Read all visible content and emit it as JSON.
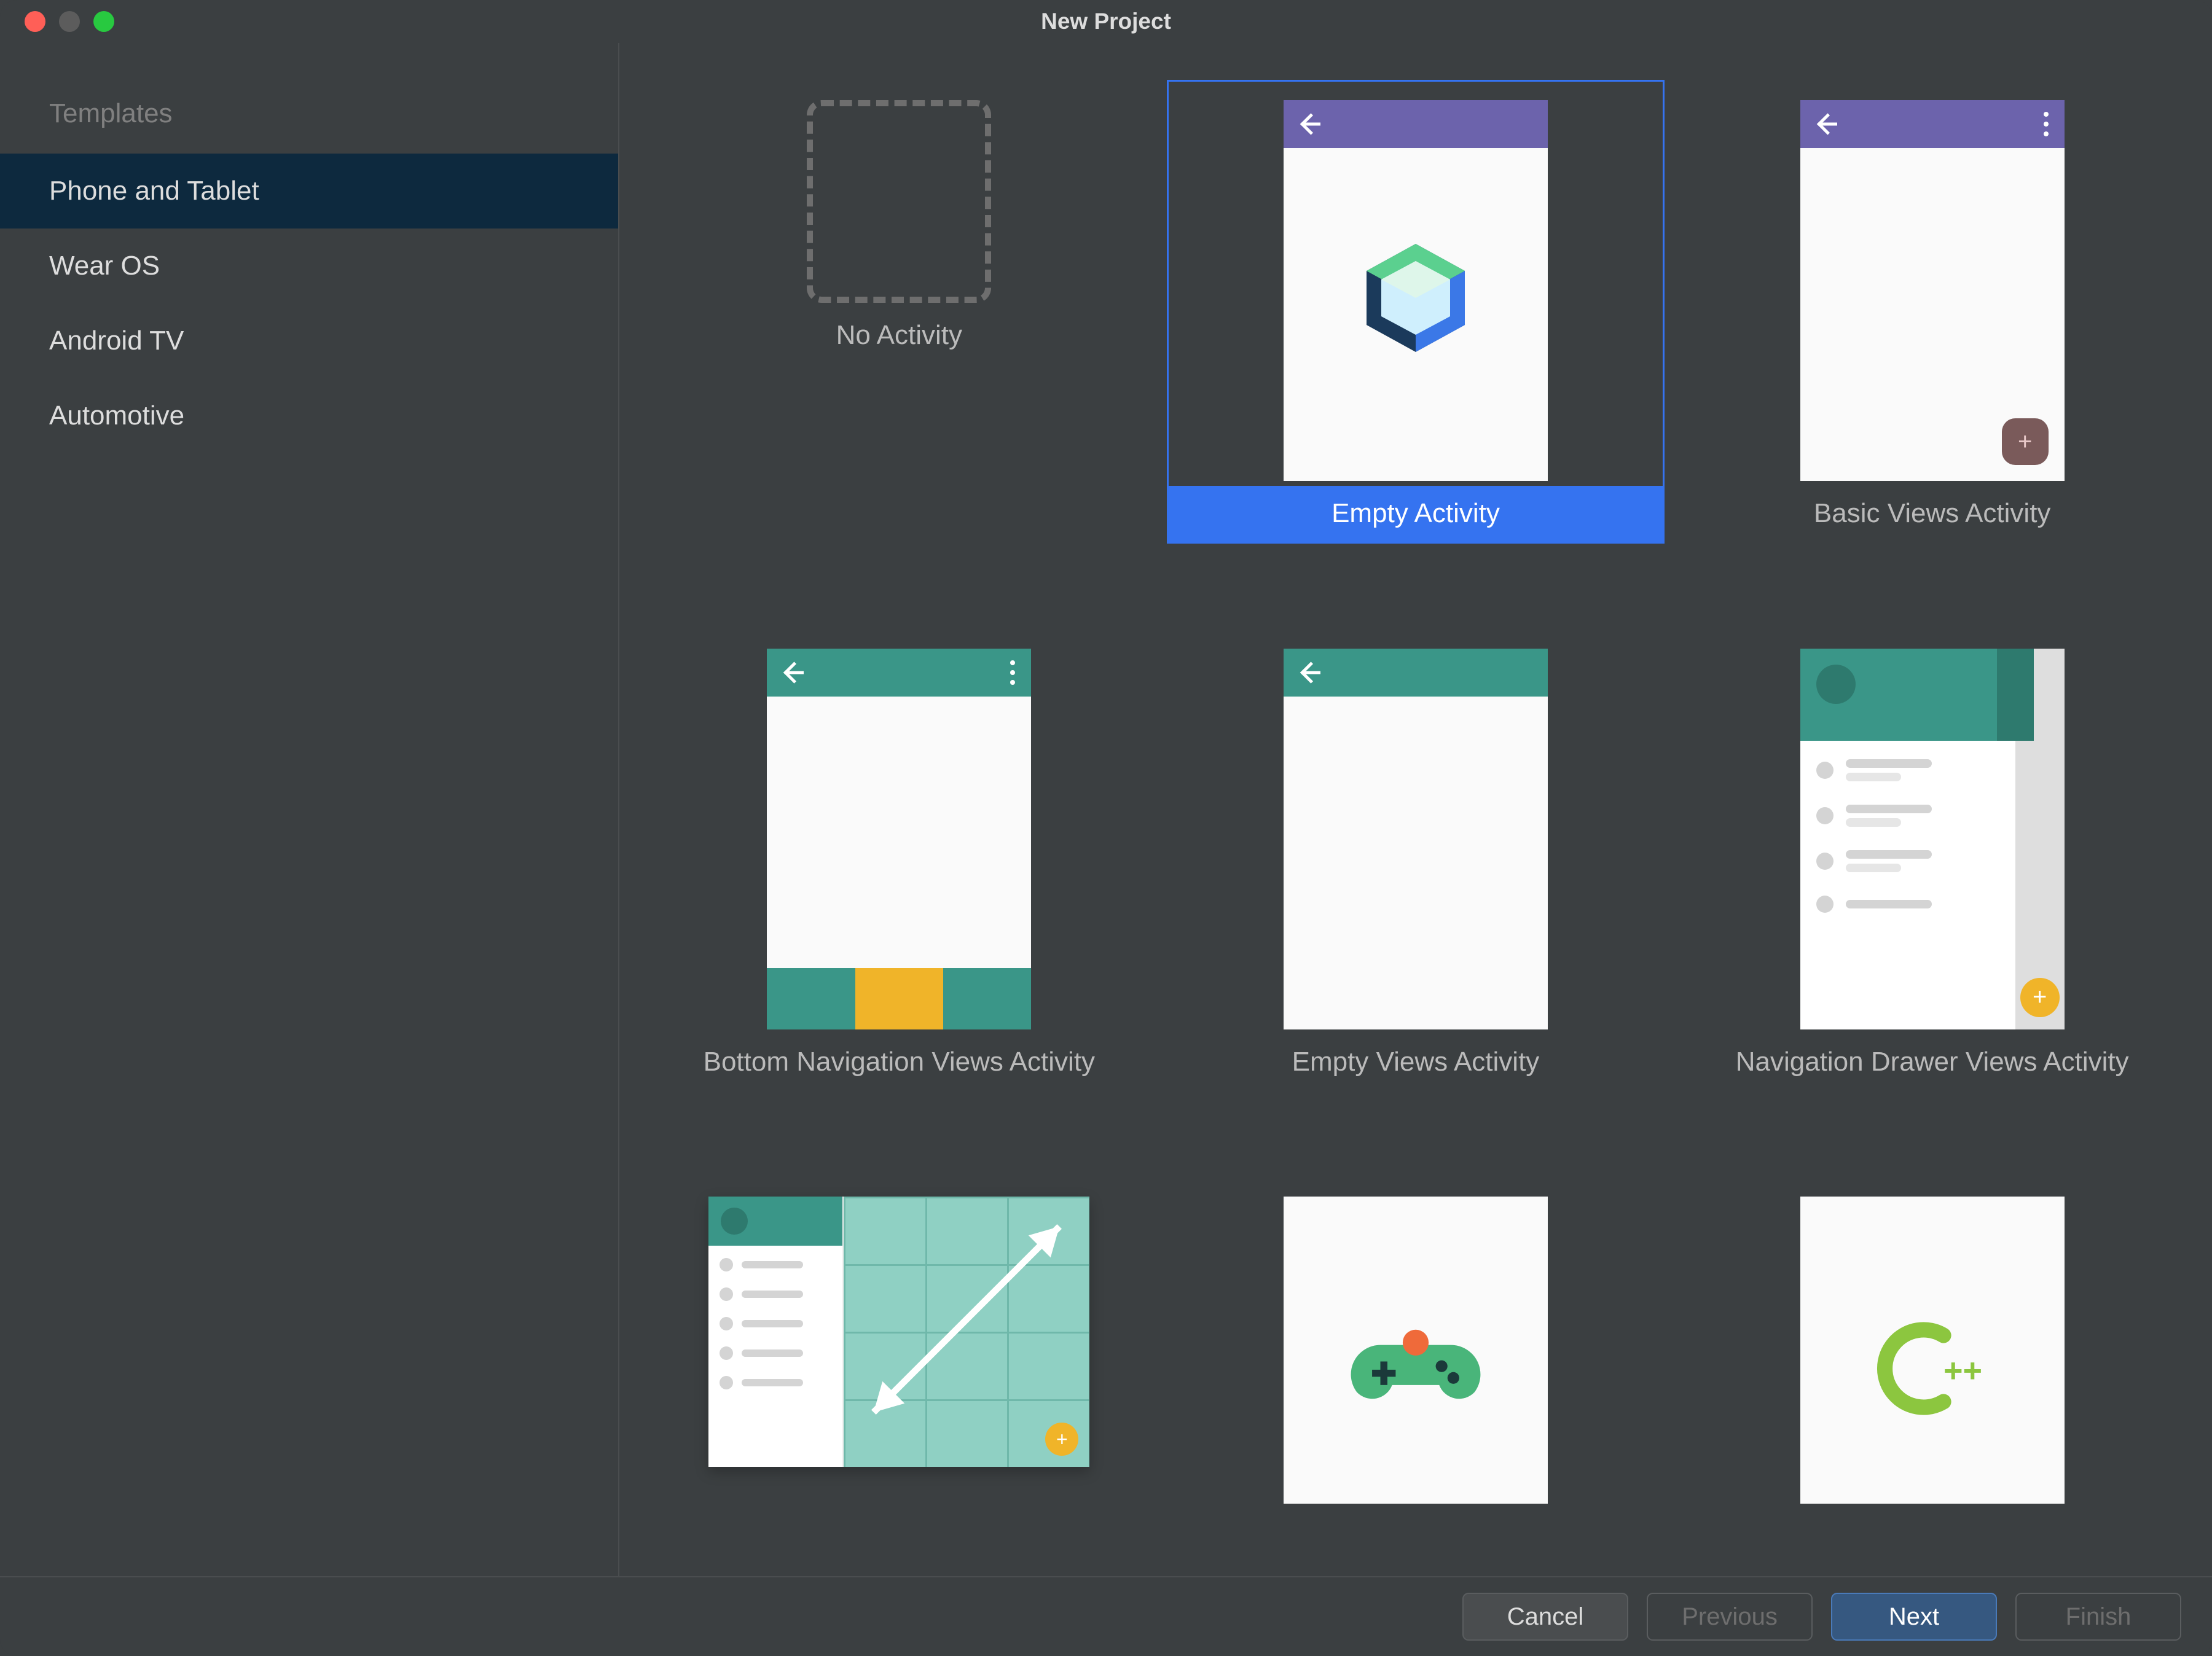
{
  "window": {
    "title": "New Project"
  },
  "sidebar": {
    "heading": "Templates",
    "items": [
      {
        "label": "Phone and Tablet",
        "selected": true
      },
      {
        "label": "Wear OS",
        "selected": false
      },
      {
        "label": "Android TV",
        "selected": false
      },
      {
        "label": "Automotive",
        "selected": false
      }
    ]
  },
  "templates": [
    {
      "label": "No Activity",
      "selected": false,
      "kind": "none"
    },
    {
      "label": "Empty Activity",
      "selected": true,
      "kind": "compose"
    },
    {
      "label": "Basic Views Activity",
      "selected": false,
      "kind": "basic"
    },
    {
      "label": "Bottom Navigation Views Activity",
      "selected": false,
      "kind": "bottomnav"
    },
    {
      "label": "Empty Views Activity",
      "selected": false,
      "kind": "emptyviews"
    },
    {
      "label": "Navigation Drawer Views Activity",
      "selected": false,
      "kind": "drawer"
    },
    {
      "label": "",
      "selected": false,
      "kind": "primarydetail"
    },
    {
      "label": "",
      "selected": false,
      "kind": "game"
    },
    {
      "label": "",
      "selected": false,
      "kind": "cpp"
    }
  ],
  "footer": {
    "cancel": "Cancel",
    "previous": "Previous",
    "next": "Next",
    "finish": "Finish"
  },
  "colors": {
    "accent_purple": "#6c63ac",
    "accent_teal": "#3a9688",
    "selection_blue": "#3573f0"
  }
}
